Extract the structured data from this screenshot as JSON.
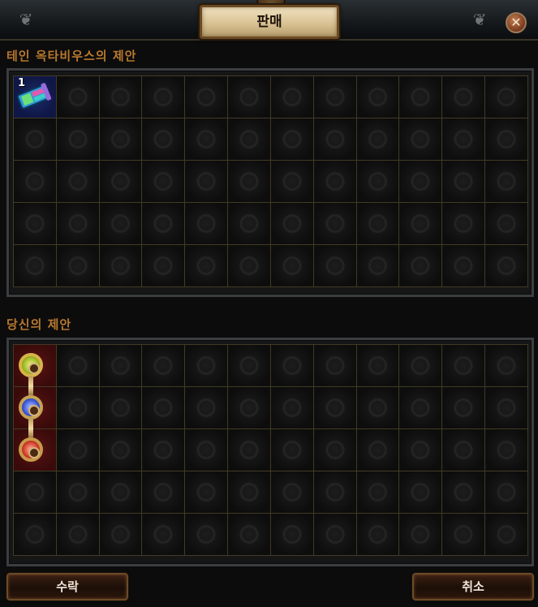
{
  "window": {
    "title": "판매",
    "close_icon": "close-icon"
  },
  "sections": [
    {
      "label": "테인 옥타비우스의 제안",
      "rows": 5,
      "columns": 12,
      "items": [
        {
          "name": "map-item",
          "row": 1,
          "col": 1,
          "stack_count": "1",
          "icon": "map-icon",
          "background": "#1c2b6a"
        }
      ]
    },
    {
      "label": "당신의 제안",
      "rows": 5,
      "columns": 12,
      "items": [
        {
          "name": "linked-ring-item",
          "row": 1,
          "col": 1,
          "row_span": 3,
          "icon": "ring-icon",
          "ring_colors": [
            "yellow",
            "blue",
            "red"
          ],
          "background": "#5a1414"
        }
      ]
    }
  ],
  "footer": {
    "accept_label": "수락",
    "cancel_label": "취소"
  },
  "colors": {
    "label_color": "#b7772f",
    "grid_line": "#413b24",
    "button_border": "#6b4a28"
  }
}
